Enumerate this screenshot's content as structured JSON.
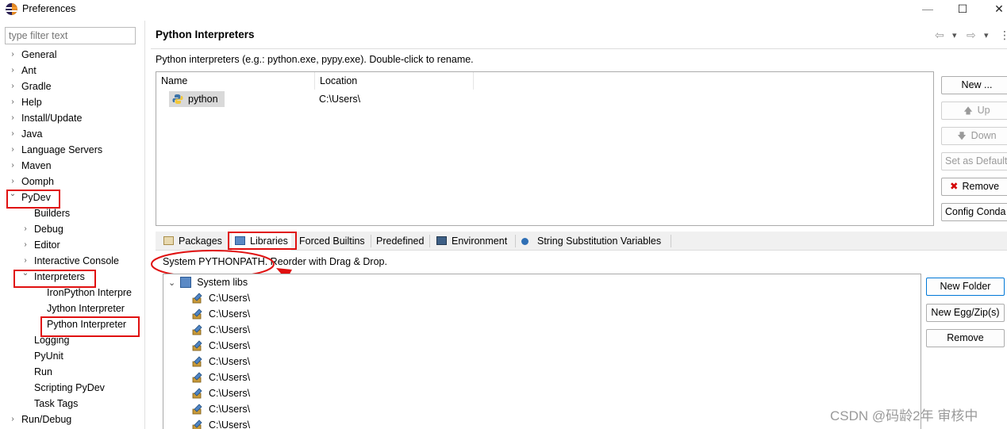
{
  "window": {
    "title": "Preferences",
    "minimize": "—",
    "maximize": "☐",
    "close": "✕"
  },
  "sidebar": {
    "filter_placeholder": "type filter text",
    "items": [
      {
        "label": "General",
        "arrow": "›"
      },
      {
        "label": "Ant",
        "arrow": "›"
      },
      {
        "label": "Gradle",
        "arrow": "›"
      },
      {
        "label": "Help",
        "arrow": "›"
      },
      {
        "label": "Install/Update",
        "arrow": "›"
      },
      {
        "label": "Java",
        "arrow": "›"
      },
      {
        "label": "Language Servers",
        "arrow": "›"
      },
      {
        "label": "Maven",
        "arrow": "›"
      },
      {
        "label": "Oomph",
        "arrow": "›"
      },
      {
        "label": "PyDev",
        "arrow": "⌄"
      },
      {
        "label": "Builders",
        "arrow": ""
      },
      {
        "label": "Debug",
        "arrow": "›"
      },
      {
        "label": "Editor",
        "arrow": "›"
      },
      {
        "label": "Interactive Console",
        "arrow": "›"
      },
      {
        "label": "Interpreters",
        "arrow": "⌄"
      },
      {
        "label": "IronPython Interpre",
        "arrow": ""
      },
      {
        "label": "Jython Interpreter",
        "arrow": ""
      },
      {
        "label": "Python Interpreter",
        "arrow": ""
      },
      {
        "label": "Logging",
        "arrow": ""
      },
      {
        "label": "PyUnit",
        "arrow": ""
      },
      {
        "label": "Run",
        "arrow": ""
      },
      {
        "label": "Scripting PyDev",
        "arrow": ""
      },
      {
        "label": "Task Tags",
        "arrow": ""
      },
      {
        "label": "Run/Debug",
        "arrow": "›"
      }
    ]
  },
  "page": {
    "title": "Python Interpreters",
    "description": "Python interpreters (e.g.: python.exe, pypy.exe).   Double-click to rename.",
    "nav": {
      "back": "⇦",
      "back_menu": "▾",
      "forward": "⇨",
      "forward_menu": "▾",
      "more": "⋮"
    }
  },
  "interpreters": {
    "columns": [
      "Name",
      "Location"
    ],
    "rows": [
      {
        "name": "python",
        "location": "C:\\Users\\"
      }
    ]
  },
  "buttons": {
    "new": "New ...",
    "up": "Up",
    "down": "Down",
    "set_default": "Set as Default",
    "remove": "Remove",
    "config_conda": "Config Conda",
    "up_icon": "🡅",
    "down_icon": "🡇",
    "remove_icon": "✖"
  },
  "tabs": [
    {
      "label": "Packages"
    },
    {
      "label": "Libraries"
    },
    {
      "label": "Forced Builtins"
    },
    {
      "label": "Predefined"
    },
    {
      "label": "Environment"
    },
    {
      "label": "String Substitution Variables"
    }
  ],
  "libraries": {
    "description": "System PYTHONPATH.   Reorder with Drag & Drop.",
    "root": "System libs",
    "root_arrow": "⌄",
    "entries": [
      "C:\\Users\\",
      "C:\\Users\\",
      "C:\\Users\\",
      "C:\\Users\\",
      "C:\\Users\\",
      "C:\\Users\\",
      "C:\\Users\\",
      "C:\\Users\\",
      "C:\\Users\\"
    ]
  },
  "lib_buttons": {
    "new_folder": "New Folder",
    "new_egg": "New Egg/Zip(s)",
    "remove": "Remove"
  },
  "watermark": "CSDN @码龄2年 审核中",
  "colors": {
    "highlight": "#e01010",
    "selection": "#d9d9d9",
    "accent_border": "#0078d7"
  }
}
